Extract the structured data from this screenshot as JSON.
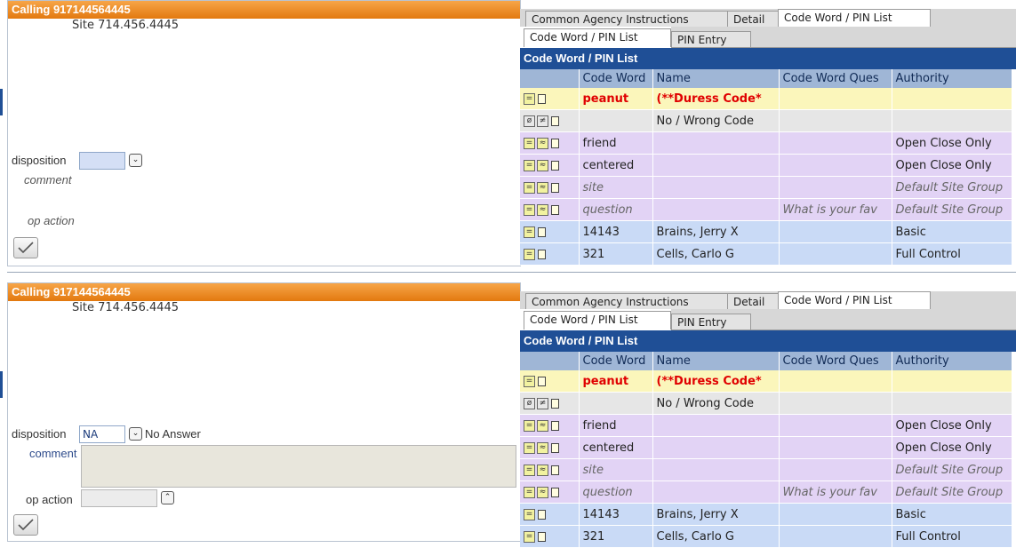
{
  "panels": [
    {
      "calling": "Calling 917144564445",
      "site": "Site 714.456.4445",
      "labels": {
        "disposition": "disposition",
        "comment": "comment",
        "op_action": "op action"
      },
      "disposition_value": "",
      "disposition_text": "",
      "tabs_top": [
        "Common Agency Instructions",
        "Detail",
        "Code Word / PIN List"
      ],
      "tabs_sub": [
        "Code Word / PIN List",
        "PIN Entry"
      ],
      "section_title": "Code Word / PIN List",
      "columns": [
        "Code Word",
        "Name",
        "Code Word Ques",
        "Authority"
      ]
    },
    {
      "calling": "Calling 917144564445",
      "site": "Site 714.456.4445",
      "labels": {
        "disposition": "disposition",
        "comment": "comment",
        "op_action": "op action"
      },
      "disposition_value": "NA",
      "disposition_text": "No Answer",
      "tabs_top": [
        "Common Agency Instructions",
        "Detail",
        "Code Word / PIN List"
      ],
      "tabs_sub": [
        "Code Word / PIN List",
        "PIN Entry"
      ],
      "section_title": "Code Word / PIN List",
      "columns": [
        "Code Word",
        "Name",
        "Code Word Ques",
        "Authority"
      ]
    }
  ],
  "rows": [
    {
      "icons": [
        "equals-icon",
        "note-icon"
      ],
      "code": "peanut",
      "name": "(**Duress Code*",
      "question": "",
      "authority": "",
      "style": "yellow"
    },
    {
      "icons": [
        "empty-set-icon",
        "not-equal-icon",
        "note-icon"
      ],
      "code": "",
      "name": "No / Wrong Code",
      "question": "",
      "authority": "",
      "style": "grey"
    },
    {
      "icons": [
        "equals-icon",
        "approx-icon",
        "note-icon"
      ],
      "code": "friend",
      "name": "",
      "question": "",
      "authority": "Open Close Only",
      "style": "purple"
    },
    {
      "icons": [
        "equals-icon",
        "approx-icon",
        "note-icon"
      ],
      "code": "centered",
      "name": "",
      "question": "",
      "authority": "Open Close Only",
      "style": "purple"
    },
    {
      "icons": [
        "equals-icon",
        "approx-icon",
        "note-icon"
      ],
      "code": "site",
      "name": "",
      "question": "",
      "authority": "Default Site Group",
      "style": "purple",
      "italic": true
    },
    {
      "icons": [
        "equals-icon",
        "approx-icon",
        "note-icon"
      ],
      "code": "question",
      "name": "",
      "question": "What is your fav",
      "authority": "Default Site Group",
      "style": "purple",
      "italic": true
    },
    {
      "icons": [
        "equals-icon",
        "note-icon"
      ],
      "code": "14143",
      "name": "Brains, Jerry X",
      "question": "",
      "authority": "Basic",
      "style": "blue"
    },
    {
      "icons": [
        "equals-icon",
        "note-icon"
      ],
      "code": "321",
      "name": "Cells, Carlo G",
      "question": "",
      "authority": "Full Control",
      "style": "blue"
    }
  ],
  "colors": {
    "accent_orange": "#e3790f",
    "header_blue": "#1f4f96",
    "duress_red": "#e00000"
  }
}
